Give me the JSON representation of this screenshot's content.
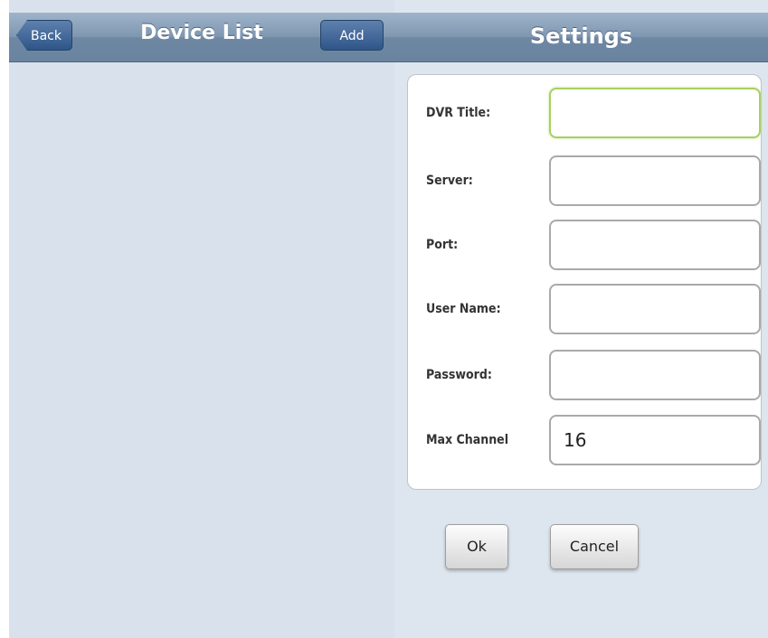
{
  "device_list": {
    "title": "Device List",
    "back_label": "Back",
    "add_label": "Add"
  },
  "settings": {
    "title": "Settings",
    "fields": [
      {
        "label": "DVR Title:",
        "value": ""
      },
      {
        "label": "Server:",
        "value": ""
      },
      {
        "label": "Port:",
        "value": ""
      },
      {
        "label": "User Name:",
        "value": ""
      },
      {
        "label": "Password:",
        "value": ""
      },
      {
        "label": "Max Channel",
        "value": "16"
      }
    ],
    "ok_label": "Ok",
    "cancel_label": "Cancel"
  }
}
